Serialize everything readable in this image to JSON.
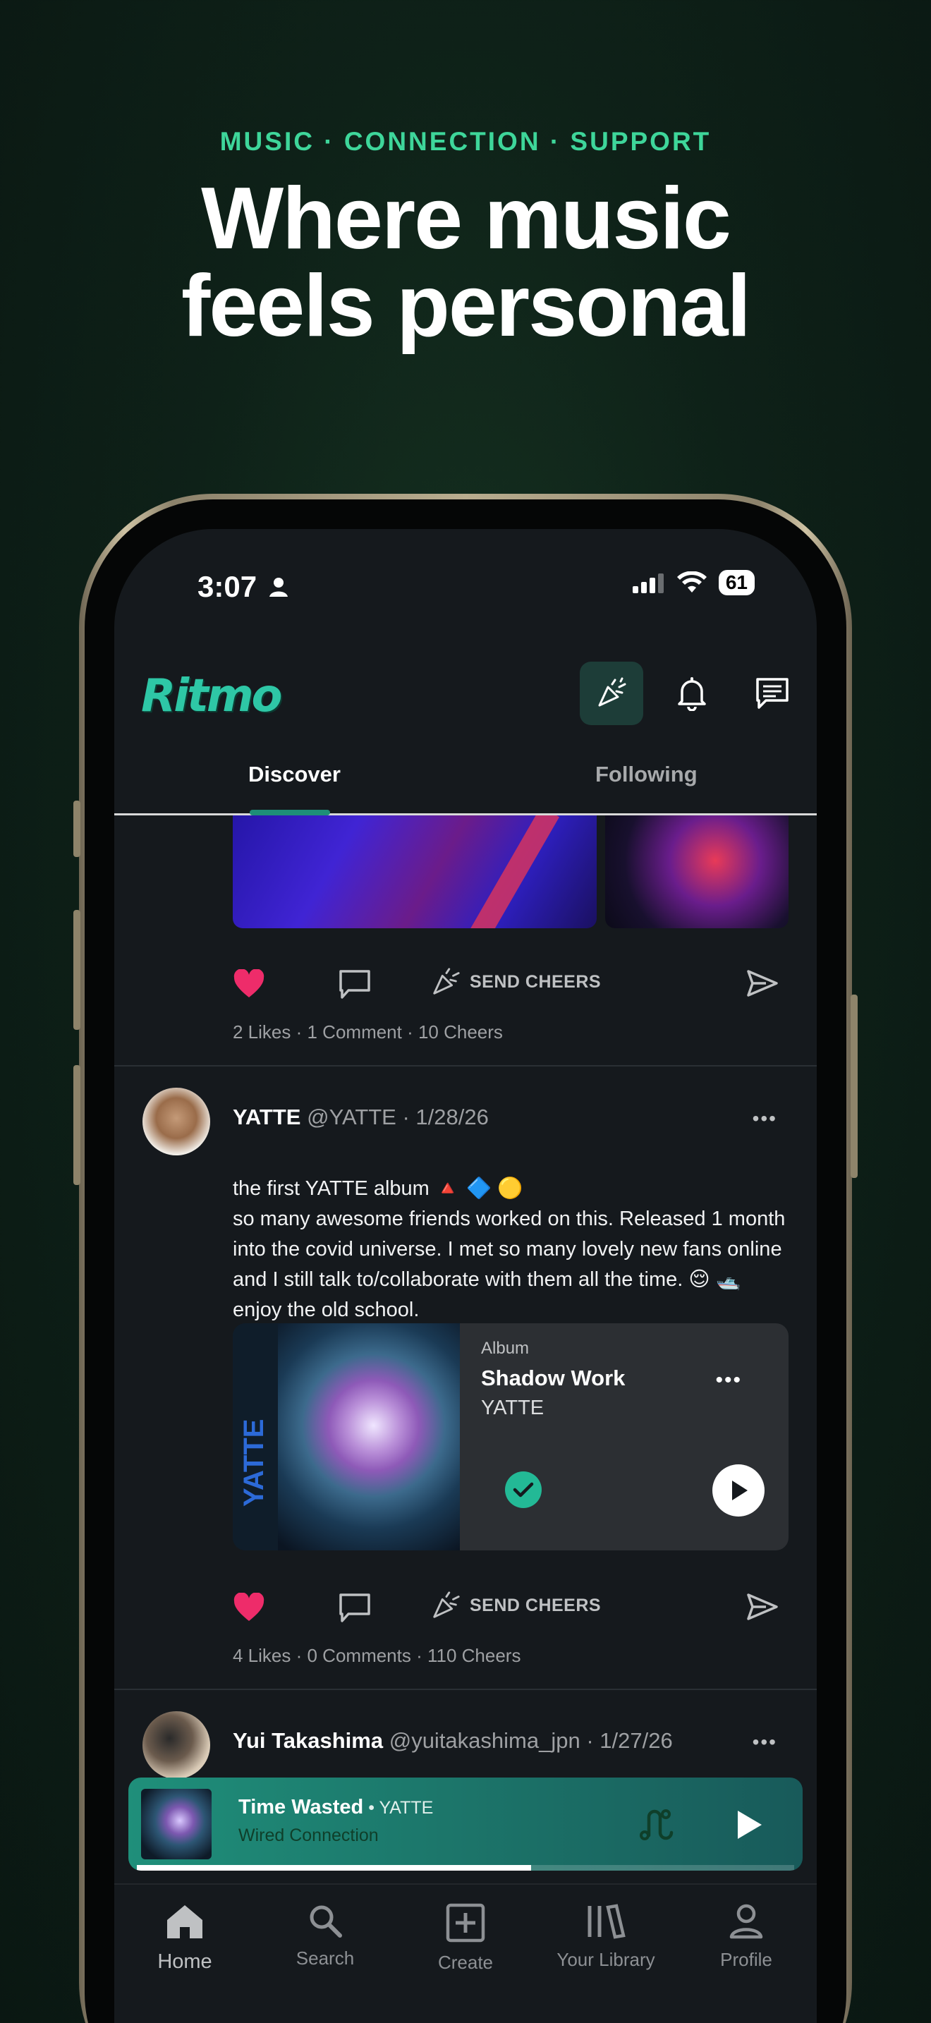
{
  "promo": {
    "tagline": "MUSIC · CONNECTION · SUPPORT",
    "headline_line1": "Where music",
    "headline_line2": "feels personal"
  },
  "status_bar": {
    "time": "3:07",
    "battery": "61"
  },
  "app": {
    "logo": "Ritmo",
    "header_icons": [
      "cheers-icon",
      "bell-icon",
      "messages-icon"
    ]
  },
  "tabs": [
    {
      "label": "Discover",
      "active": true
    },
    {
      "label": "Following",
      "active": false
    }
  ],
  "posts": [
    {
      "actions": {
        "cheers_label": "SEND CHEERS"
      },
      "stats": "2 Likes · 1 Comment · 10 Cheers"
    },
    {
      "name": "YATTE",
      "handle": "@YATTE · 1/28/26",
      "text_lines": [
        "the first YATTE album 🔺 🔷 🟡",
        "so many awesome friends worked on this. Released 1 month",
        "into the covid universe. I met so many lovely new fans online",
        "and I still talk to/collaborate with them all the time. 😌 🛥️",
        "enjoy the old school."
      ],
      "album": {
        "type": "Album",
        "title": "Shadow Work",
        "artist": "YATTE",
        "art_spine_text": "YATTE"
      },
      "actions": {
        "cheers_label": "SEND CHEERS"
      },
      "stats": "4 Likes · 0 Comments · 110 Cheers"
    },
    {
      "name": "Yui Takashima",
      "handle": "@yuitakashima_jpn · 1/27/26"
    }
  ],
  "mini_player": {
    "title": "Time Wasted",
    "artist": " • YATTE",
    "subtitle": "Wired Connection",
    "progress": 0.6
  },
  "bottom_nav": [
    {
      "label": "Home",
      "icon": "home-icon",
      "active": true
    },
    {
      "label": "Search",
      "icon": "search-icon",
      "active": false
    },
    {
      "label": "Create",
      "icon": "create-icon",
      "active": false
    },
    {
      "label": "Your Library",
      "icon": "library-icon",
      "active": false
    },
    {
      "label": "Profile",
      "icon": "profile-icon",
      "active": false
    }
  ],
  "colors": {
    "accent": "#3ed69a",
    "like": "#ee2c6a",
    "miniplayer": "#1f8f7a"
  }
}
